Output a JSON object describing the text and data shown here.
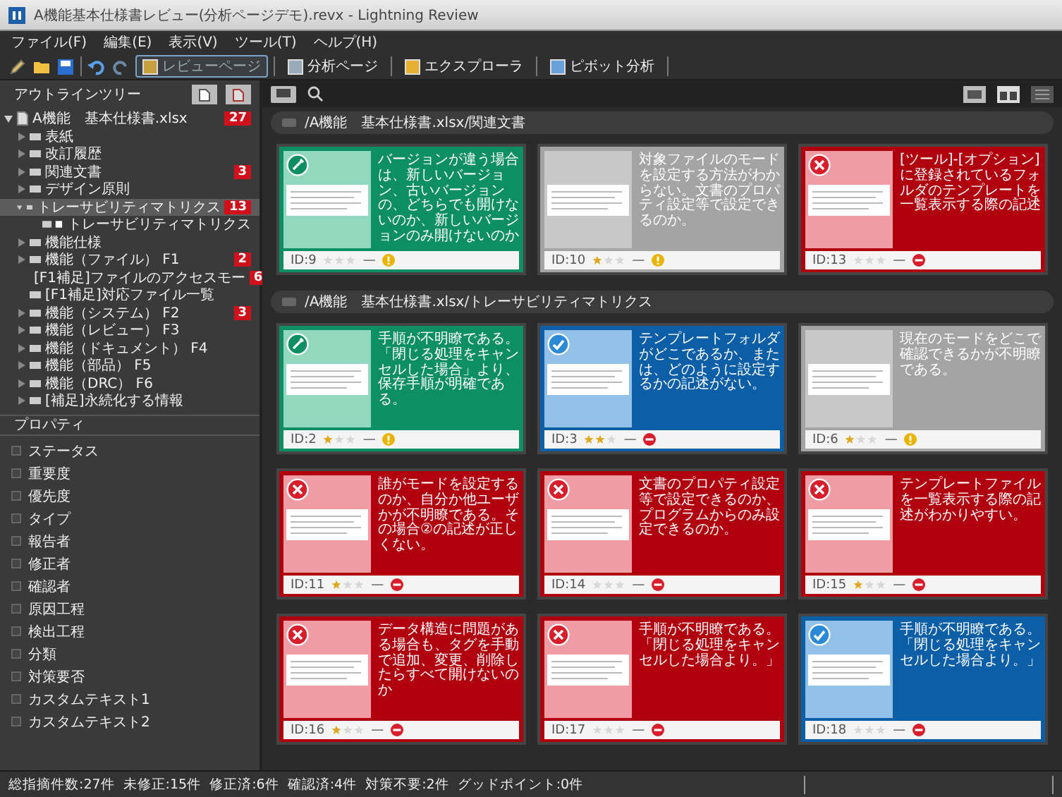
{
  "window": {
    "title": "A機能基本仕様書レビュー(分析ページデモ).revx - Lightning Review"
  },
  "menu": [
    "ファイル(F)",
    "編集(E)",
    "表示(V)",
    "ツール(T)",
    "ヘルプ(H)"
  ],
  "toolbar": {
    "buttons": [
      {
        "label": "レビューページ",
        "selected": true,
        "kind": "review"
      },
      {
        "label": "分析ページ",
        "selected": false,
        "kind": "analysis"
      },
      {
        "label": "エクスプローラ",
        "selected": false,
        "kind": "explorer"
      },
      {
        "label": "ピボット分析",
        "selected": false,
        "kind": "pivot"
      }
    ]
  },
  "outline": {
    "title": "アウトラインツリー",
    "items": [
      {
        "label": "A機能　基本仕様書.xlsx",
        "count": "27",
        "kind": "file",
        "expanded": true,
        "selected": false,
        "children": [
          {
            "label": "表紙",
            "kind": "sheet",
            "expanded": false,
            "selected": false
          },
          {
            "label": "改訂履歴",
            "kind": "sheet",
            "expanded": false,
            "selected": false
          },
          {
            "label": "関連文書",
            "count": "3",
            "kind": "sheet",
            "expanded": false,
            "selected": false
          },
          {
            "label": "デザイン原則",
            "kind": "sheet",
            "expanded": false,
            "selected": false
          },
          {
            "label": "トレーサビリティマトリクス",
            "count": "13",
            "kind": "sheet",
            "expanded": true,
            "selected": true,
            "children": [
              {
                "label": "トレーサビリティマトリクス",
                "kind": "table",
                "selected": false
              }
            ]
          },
          {
            "label": "機能仕様",
            "kind": "sheet",
            "expanded": false,
            "selected": false
          },
          {
            "label": "機能（ファイル）  F1",
            "count": "2",
            "kind": "sheet",
            "expanded": false,
            "selected": false
          },
          {
            "label": "[F1補足]ファイルのアクセスモー",
            "count": "6",
            "kind": "leaf",
            "selected": false
          },
          {
            "label": "[F1補足]対応ファイル一覧",
            "kind": "leaf",
            "selected": false
          },
          {
            "label": "機能（システム）  F2",
            "count": "3",
            "kind": "sheet",
            "expanded": false,
            "selected": false
          },
          {
            "label": "機能（レビュー）  F3",
            "kind": "sheet",
            "expanded": false,
            "selected": false
          },
          {
            "label": "機能（ドキュメント）  F4",
            "kind": "sheet",
            "expanded": false,
            "selected": false
          },
          {
            "label": "機能（部品）  F5",
            "kind": "sheet",
            "expanded": false,
            "selected": false
          },
          {
            "label": "機能（DRC）  F6",
            "kind": "sheet",
            "expanded": false,
            "selected": false
          },
          {
            "label": "[補足]永続化する情報",
            "kind": "sheet",
            "expanded": false,
            "selected": false
          }
        ]
      }
    ]
  },
  "properties": {
    "title": "プロパティ",
    "items": [
      {
        "label": "ステータス",
        "checked": false
      },
      {
        "label": "重要度",
        "checked": false
      },
      {
        "label": "優先度",
        "checked": false
      },
      {
        "label": "タイプ",
        "checked": false
      },
      {
        "label": "報告者",
        "checked": false
      },
      {
        "label": "修正者",
        "checked": false
      },
      {
        "label": "確認者",
        "checked": false
      },
      {
        "label": "原因工程",
        "checked": false
      },
      {
        "label": "検出工程",
        "checked": false
      },
      {
        "label": "分類",
        "checked": false
      },
      {
        "label": "対策要否",
        "checked": false
      },
      {
        "label": "カスタムテキスト1",
        "checked": false
      },
      {
        "label": "カスタムテキスト2",
        "checked": false
      }
    ]
  },
  "groups": [
    {
      "path": "/A機能　基本仕様書.xlsx/関連文書",
      "cards": [
        {
          "id": "ID:9",
          "kind": "in_progress",
          "stars": 0,
          "marker": "—",
          "blocked": false,
          "text": "バージョンが違う場合は、新しいバージョン、古いバージョンの、どちらでも開けないのか、新しいバージョンのみ開けないのか"
        },
        {
          "id": "ID:10",
          "kind": "open",
          "stars": 1,
          "marker": "—",
          "blocked": false,
          "text": "対象ファイルのモードを設定する方法がわからない。文書のプロパティ設定等で設定できるのか。"
        },
        {
          "id": "ID:13",
          "kind": "rejected",
          "stars": 0,
          "marker": "—",
          "blocked": true,
          "text": "[ツール]-[オプション]に登録されているフォルダのテンプレートを一覧表示する際の記述"
        }
      ]
    },
    {
      "path": "/A機能　基本仕様書.xlsx/トレーサビリティマトリクス",
      "cards": [
        {
          "id": "ID:2",
          "kind": "in_progress",
          "stars": 1,
          "marker": "—",
          "blocked": false,
          "text": "手順が不明瞭である。「閉じる処理をキャンセルした場合」より、保存手順が明確である。"
        },
        {
          "id": "ID:3",
          "kind": "done",
          "stars": 2,
          "marker": "—",
          "blocked": true,
          "text": "テンプレートフォルダがどこであるか、または、どのように設定するかの記述がない。"
        },
        {
          "id": "ID:6",
          "kind": "open",
          "stars": 1,
          "marker": "—",
          "blocked": false,
          "text": "現在のモードをどこで確認できるかが不明瞭である。"
        },
        {
          "id": "ID:11",
          "kind": "rejected",
          "stars": 1,
          "marker": "—",
          "blocked": true,
          "text": "誰がモードを設定するのか、自分か他ユーザかが不明瞭である。その場合②の記述が正しくない。"
        },
        {
          "id": "ID:14",
          "kind": "rejected",
          "stars": 0,
          "marker": "—",
          "blocked": true,
          "text": "文書のプロパティ設定等で設定できるのか、プログラムからのみ設定できるのか。"
        },
        {
          "id": "ID:15",
          "kind": "rejected",
          "stars": 1,
          "marker": "—",
          "blocked": true,
          "text": "テンプレートファイルを一覧表示する際の記述がわかりやすい。"
        },
        {
          "id": "ID:16",
          "kind": "rejected",
          "stars": 1,
          "marker": "—",
          "blocked": true,
          "text": "データ構造に問題がある場合も、タグを手動で追加、変更、削除したらすべて開けないのか"
        },
        {
          "id": "ID:17",
          "kind": "rejected",
          "stars": 0,
          "marker": "—",
          "blocked": true,
          "text": "手順が不明瞭である。「閉じる処理をキャンセルした場合より。」"
        },
        {
          "id": "ID:18",
          "kind": "done",
          "stars": 0,
          "marker": "—",
          "blocked": true,
          "text": "手順が不明瞭である。「閉じる処理をキャンセルした場合より。」"
        }
      ]
    }
  ],
  "status_bar": [
    "総指摘件数:27件",
    "未修正:15件",
    "修正済:6件",
    "確認済:4件",
    "対策不要:2件",
    "グッドポイント:0件"
  ]
}
